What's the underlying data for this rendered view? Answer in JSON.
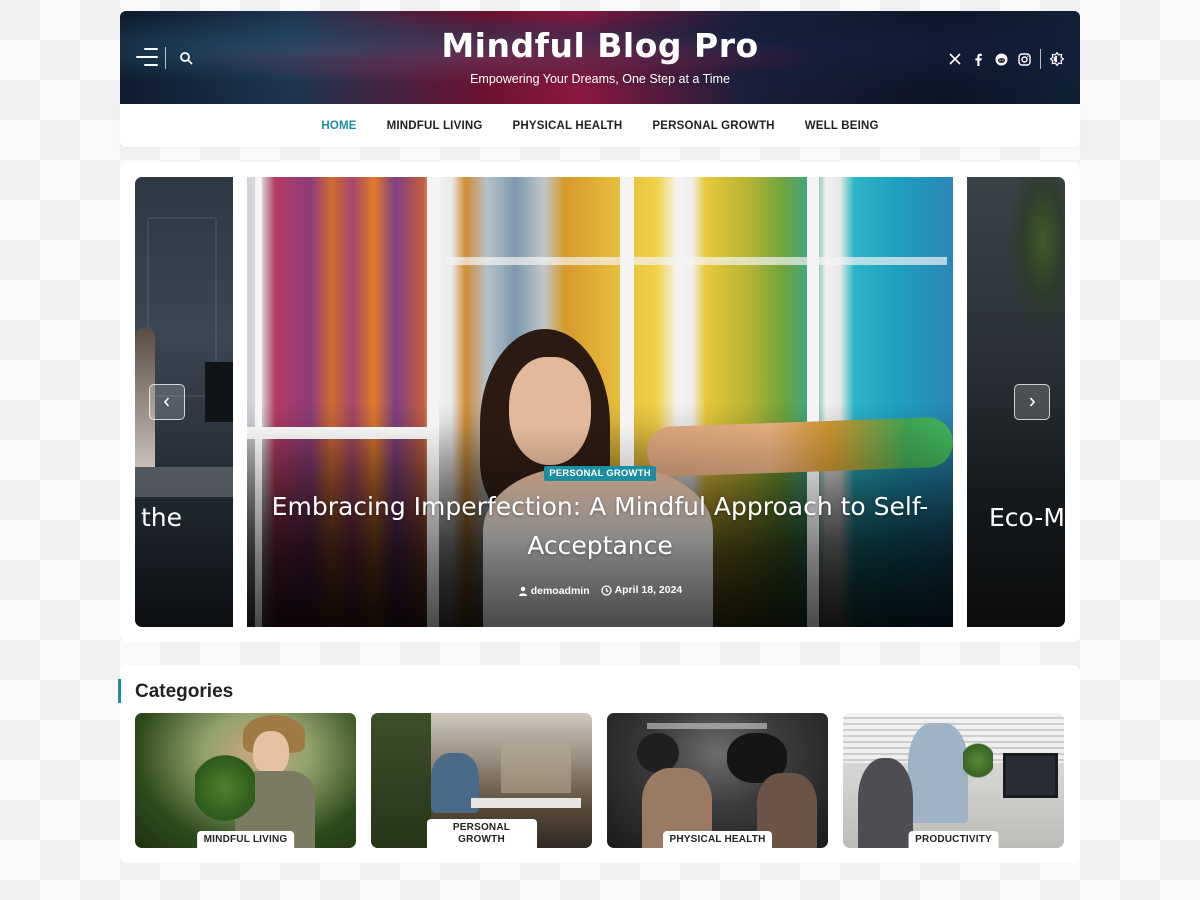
{
  "header": {
    "title": "Mindful Blog Pro",
    "tagline": "Empowering Your Dreams, One Step at a Time",
    "left_icons": [
      "menu-icon",
      "search-icon"
    ],
    "social_icons": [
      "x-icon",
      "facebook-icon",
      "reddit-icon",
      "instagram-icon",
      "theme-toggle-icon"
    ]
  },
  "nav": {
    "items": [
      {
        "label": "HOME",
        "active": true
      },
      {
        "label": "MINDFUL LIVING",
        "active": false
      },
      {
        "label": "PHYSICAL HEALTH",
        "active": false
      },
      {
        "label": "PERSONAL GROWTH",
        "active": false
      },
      {
        "label": "WELL BEING",
        "active": false
      }
    ],
    "active_color": "#1c8ea1"
  },
  "slider": {
    "prev_partial_title": "the",
    "next_partial_title": "Eco-M",
    "current": {
      "category": "PERSONAL GROWTH",
      "title": "Embracing Imperfection: A Mindful Approach to Self-Acceptance",
      "author": "demoadmin",
      "date": "April 18, 2024"
    },
    "prev_icon": "chevron-left-icon",
    "next_icon": "chevron-right-icon"
  },
  "categories": {
    "heading": "Categories",
    "items": [
      {
        "label": "MINDFUL LIVING"
      },
      {
        "label": "PERSONAL GROWTH"
      },
      {
        "label": "PHYSICAL HEALTH"
      },
      {
        "label": "PRODUCTIVITY"
      }
    ]
  },
  "colors": {
    "accent": "#1c8ea1",
    "page_bg": "#f1f1f2"
  }
}
